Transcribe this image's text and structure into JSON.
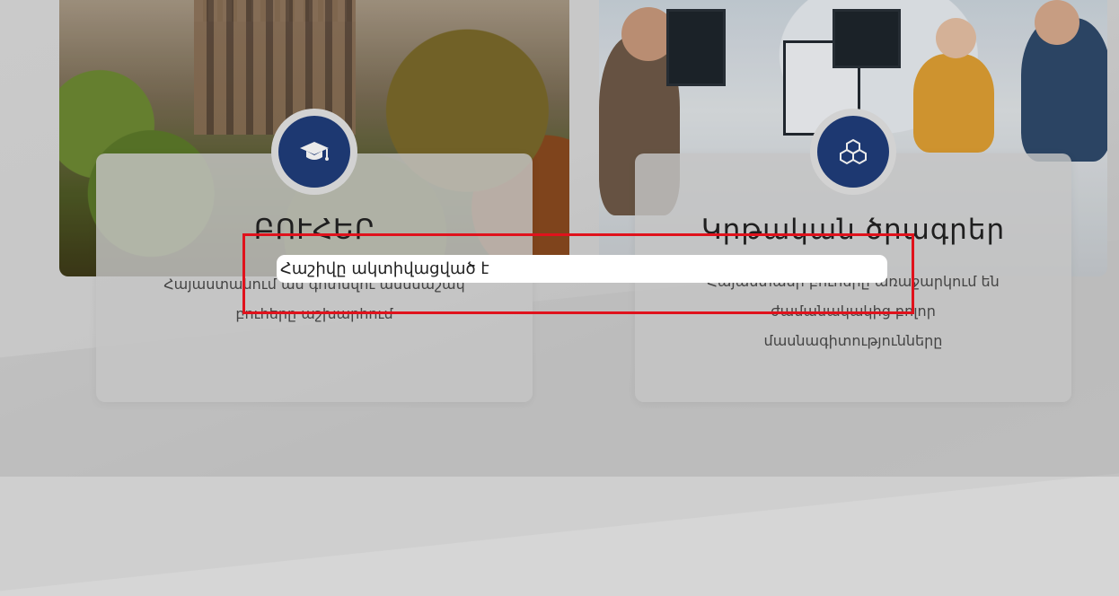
{
  "cards": [
    {
      "title": "ԲՈՒՀԵՐ",
      "description_lines": [
        "Հայաստանում ամ գոտնվու ասսնաշակ",
        "բուհերը աշխարհում"
      ],
      "icon": "graduation-cap-icon"
    },
    {
      "title": "Կրթական ծրագրեր",
      "description_lines": [
        "Հայաստանի բուհերը առաջարկում են",
        "ժամանակակից բոլոր",
        "մասնագիտությունները"
      ],
      "icon": "cubes-icon"
    }
  ],
  "toast": {
    "message": "Հաշիվը ակտիվացված է"
  },
  "colors": {
    "icon_circle": "#203d7b",
    "highlight": "#e0121c"
  }
}
